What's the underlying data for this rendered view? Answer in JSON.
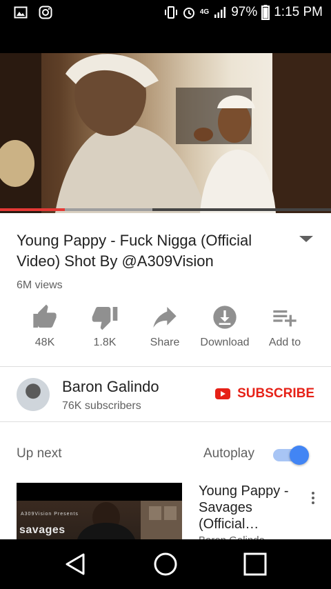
{
  "status_bar": {
    "battery": "97%",
    "time": "1:15 PM",
    "network": "4G",
    "icons": [
      "gallery-icon",
      "instagram-icon",
      "vibrate-icon",
      "alarm-icon",
      "data-arrows-icon",
      "signal-icon",
      "battery-icon"
    ]
  },
  "video": {
    "progress_played": 0.195,
    "progress_buffered": 0.46,
    "title": "Young Pappy - Fuck Nigga (Official Video) Shot By @A309Vision",
    "views": "6M views"
  },
  "actions": [
    {
      "label": "48K",
      "icon": "thumbs-up-icon"
    },
    {
      "label": "1.8K",
      "icon": "thumbs-down-icon"
    },
    {
      "label": "Share",
      "icon": "share-icon"
    },
    {
      "label": "Download",
      "icon": "download-icon"
    },
    {
      "label": "Add to",
      "icon": "add-to-playlist-icon"
    }
  ],
  "channel": {
    "name": "Baron Galindo",
    "subscribers": "76K subscribers",
    "subscribe_label": "SUBSCRIBE"
  },
  "up_next": {
    "label": "Up next",
    "autoplay_label": "Autoplay",
    "autoplay_on": true,
    "item": {
      "title": "Young Pappy - Savages (Official…",
      "thumb_text": "savages",
      "thumb_tag": "A309Vision Presents",
      "channel": "Baron Galindo"
    }
  },
  "colors": {
    "accent_red": "#e62117",
    "progress_red": "#e53935",
    "toggle_blue": "#4285f4"
  }
}
